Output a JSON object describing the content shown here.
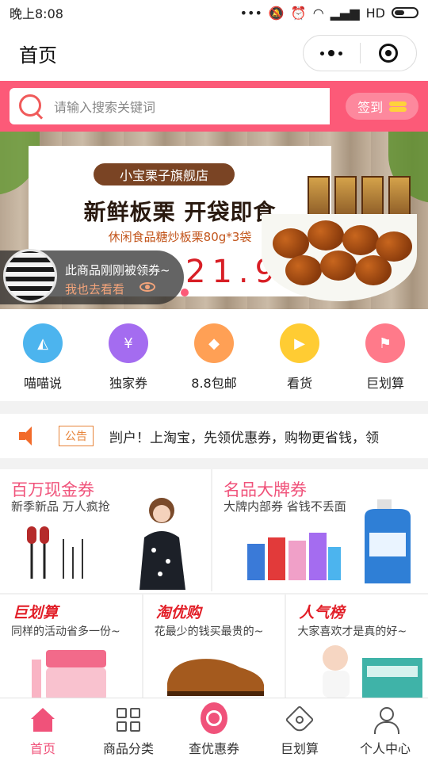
{
  "status_bar": {
    "time": "晚上8:08",
    "network": "HD"
  },
  "nav": {
    "title": "首页"
  },
  "search": {
    "placeholder": "请输入搜索关键词",
    "signin_label": "签到"
  },
  "banner": {
    "shop_name": "小宝栗子旗舰店",
    "headline": "新鲜板栗  开袋即食",
    "subtitle": "休闲食品糖炒板栗80g*3袋",
    "price": "21.9",
    "toast_line1": "此商品刚刚被领券~",
    "toast_line2": "我也去看看",
    "active_slide": 1,
    "slide_count": 4
  },
  "shortcuts": [
    {
      "label": "喵喵说",
      "color": "#4cb4ee",
      "icon": "cat-icon",
      "glyph": "◭"
    },
    {
      "label": "独家券",
      "color": "#a46cf0",
      "icon": "coupon-icon",
      "glyph": "¥"
    },
    {
      "label": "8.8包邮",
      "color": "#ffa055",
      "icon": "diamond-icon",
      "glyph": "◆"
    },
    {
      "label": "看货",
      "color": "#ffcc33",
      "icon": "video-icon",
      "glyph": "▶"
    },
    {
      "label": "巨划算",
      "color": "#ff7a8a",
      "icon": "flag-icon",
      "glyph": "⚑"
    }
  ],
  "notice": {
    "badge": "公告",
    "text": "剀户！上淘宝，先领优惠券，购物更省钱，领"
  },
  "promos_big": [
    {
      "title": "百万现金券",
      "subtitle": "新季新品 万人疯抢"
    },
    {
      "title": "名品大牌券",
      "subtitle": "大牌内部券 省钱不丢面"
    }
  ],
  "promos_small": [
    {
      "title": "巨划算",
      "subtitle": "同样的活动省多一份~"
    },
    {
      "title": "淘优购",
      "subtitle": "花最少的钱买最贵的~"
    },
    {
      "title": "人气榜",
      "subtitle": "大家喜欢才是真的好~"
    }
  ],
  "tabbar": [
    {
      "label": "首页",
      "active": true
    },
    {
      "label": "商品分类",
      "active": false
    },
    {
      "label": "查优惠券",
      "active": false
    },
    {
      "label": "巨划算",
      "active": false
    },
    {
      "label": "个人中心",
      "active": false
    }
  ],
  "colors": {
    "accent": "#fc5a78",
    "brand_pink": "#f0527a",
    "notice_orange": "#e7843a"
  }
}
